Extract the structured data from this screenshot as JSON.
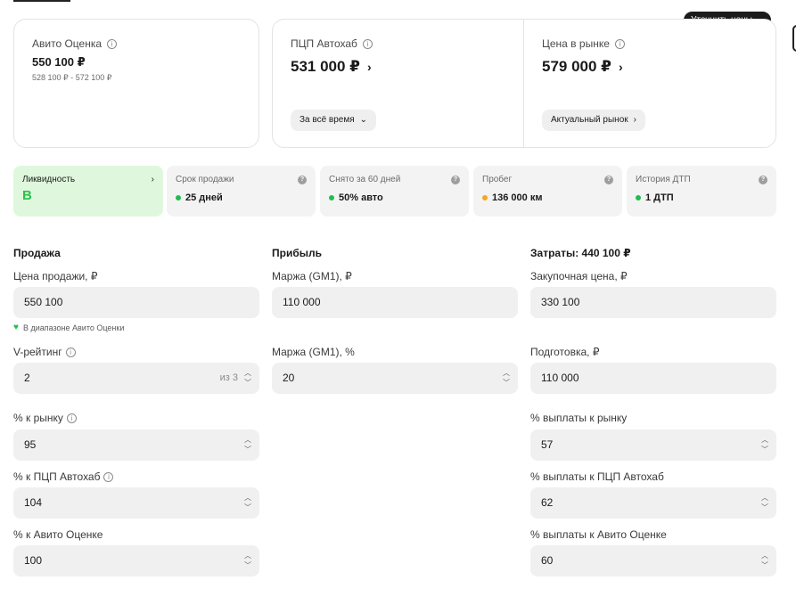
{
  "header": {
    "refine_label": "Уточнить цены",
    "refine_icon": "sliders-icon"
  },
  "avito": {
    "label": "Авито Оценка",
    "value": "550 100 ₽",
    "range": "528 100 ₽ - 572 100 ₽"
  },
  "pcp": {
    "label": "ПЦП Автохаб",
    "value": "531 000 ₽",
    "pill": "За всё время"
  },
  "market": {
    "label": "Цена в рынке",
    "value": "579 000 ₽",
    "pill": "Актуальный рынок"
  },
  "metrics": [
    {
      "label": "Ликвидность",
      "value": "B"
    },
    {
      "label": "Срок продажи",
      "value": "25 дней",
      "dot": "#1fbf4d"
    },
    {
      "label": "Снято за 60 дней",
      "value": "50% авто",
      "dot": "#1fbf4d"
    },
    {
      "label": "Пробег",
      "value": "136 000 км",
      "dot": "#f4a623"
    },
    {
      "label": "История ДТП",
      "value": "1 ДТП",
      "dot": "#1fbf4d"
    }
  ],
  "sale": {
    "title": "Продажа",
    "price_label": "Цена продажи, ₽",
    "price_value": "550 100",
    "hint": "В диапазоне Авито Оценки",
    "rating_label": "V-рейтинг",
    "rating_value": "2",
    "rating_suffix": "из 3",
    "market_pct_label": "% к рынку",
    "market_pct_value": "95",
    "pcp_pct_label": "% к ПЦП Автохаб",
    "pcp_pct_value": "104",
    "avito_pct_label": "% к Авито Оценке",
    "avito_pct_value": "100"
  },
  "profit": {
    "title": "Прибыль",
    "margin_rub_label": "Маржа (GM1), ₽",
    "margin_rub_value": "110 000",
    "margin_pct_label": "Маржа (GM1), %",
    "margin_pct_value": "20"
  },
  "costs": {
    "title": "Затраты: 440 100 ₽",
    "purchase_label": "Закупочная цена, ₽",
    "purchase_value": "330 100",
    "prep_label": "Подготовка, ₽",
    "prep_value": "110 000",
    "payout_market_label": "% выплаты к рынку",
    "payout_market_value": "57",
    "payout_pcp_label": "% выплаты к ПЦП Автохаб",
    "payout_pcp_value": "62",
    "payout_avito_label": "% выплаты к Авито Оценке",
    "payout_avito_value": "60"
  },
  "colors": {
    "accent_green": "#27c24c",
    "liquidity_bg": "#dff8dd",
    "warning_orange": "#f4a623",
    "dark_button": "#1b1b1b"
  }
}
